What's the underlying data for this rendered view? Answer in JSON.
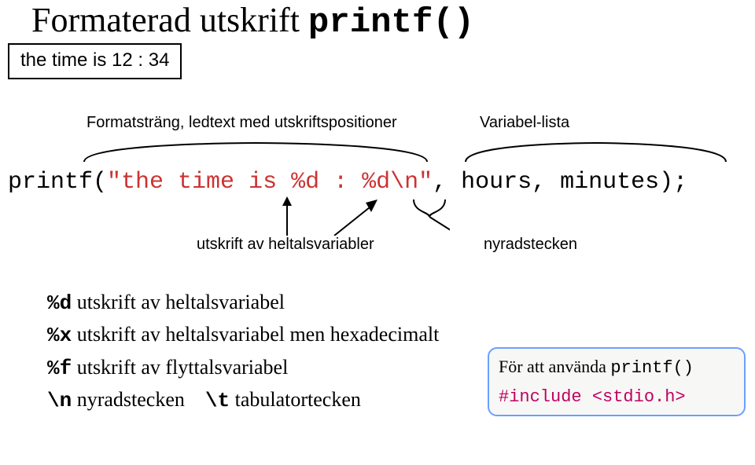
{
  "title": {
    "text": "Formaterad utskrift ",
    "code": "printf()"
  },
  "output_box": "the time is 12 : 34",
  "annotations": {
    "top_left": "Formatsträng, ledtext med utskriftspositioner",
    "top_right": "Variabel-lista",
    "bottom_left": "utskrift av heltalsvariabler",
    "bottom_right": "nyradstecken"
  },
  "code": {
    "prefix": "printf(",
    "string": "\"the time is %d : %d\\n\"",
    "suffix": ", hours, minutes);"
  },
  "bullets": {
    "d_code": "%d",
    "d_text": "utskrift av heltalsvariabel",
    "x_code": "%x",
    "x_text": "utskrift av heltalsvariabel men hexadecimalt",
    "f_code": "%f",
    "f_text": "utskrift av flyttalsvariabel",
    "n_code": "\\n",
    "n_text": "nyradstecken",
    "t_code": "\\t",
    "t_text": "tabulatortecken"
  },
  "info_box": {
    "line1_pre": "För att använda ",
    "line1_code": "printf()",
    "line2": "#include <stdio.h>"
  }
}
